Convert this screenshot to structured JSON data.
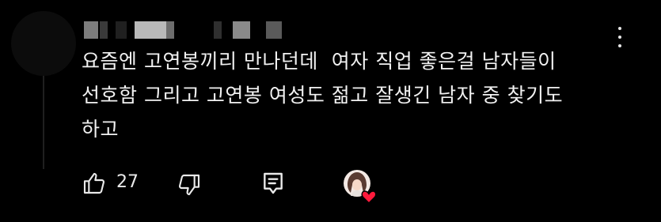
{
  "comment": {
    "text": "요즘엔 고연봉끼리 만나던데  여자 직업 좋은걸 남자들이\n선호함 그리고 고연봉 여성도 젊고 잘생긴 남자 중 찾기도\n하고"
  },
  "actions": {
    "like_count": "27"
  },
  "icons": {
    "more": "more-vert-icon",
    "like": "thumbs-up-icon",
    "dislike": "thumbs-down-icon",
    "reply": "reply-comment-icon",
    "creator_heart": "creator-heart-icon"
  },
  "colors": {
    "background": "#000000",
    "text": "#f1f1f1",
    "heart": "#ff1a3c"
  }
}
